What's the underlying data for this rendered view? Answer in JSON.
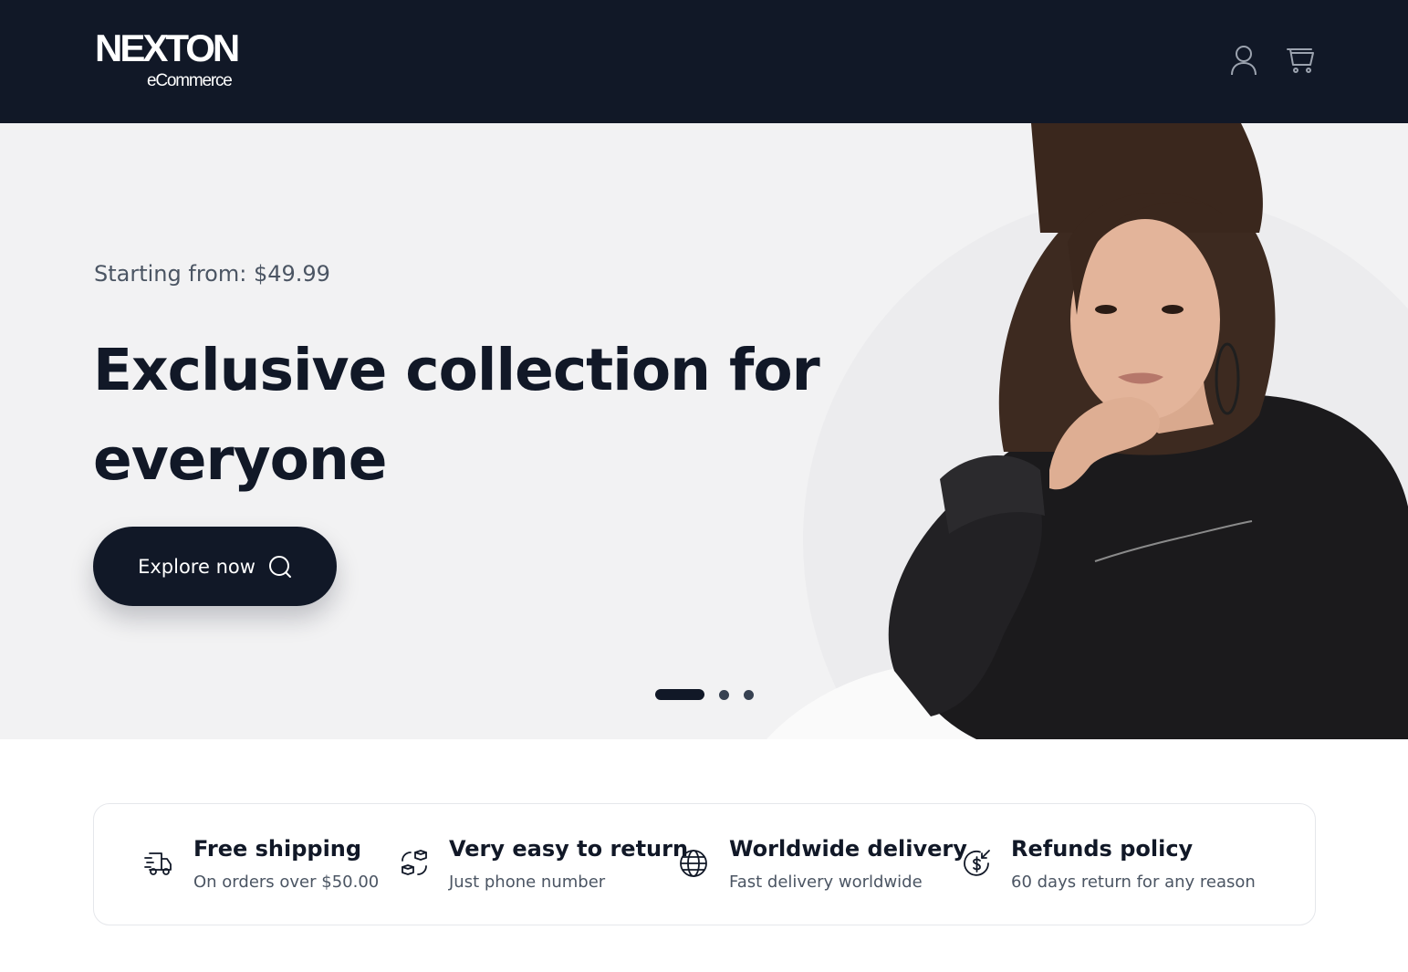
{
  "header": {
    "logo_main": "NEXTON",
    "logo_sub": "eCommerce",
    "icons": [
      "user-icon",
      "cart-icon"
    ]
  },
  "hero": {
    "subtitle": "Starting from: $49.99",
    "title": "Exclusive collection for everyone",
    "button_label": "Explore now",
    "button_icon": "search-icon",
    "slides_total": 3,
    "active_slide": 1
  },
  "features": [
    {
      "icon": "truck-icon",
      "title": "Free shipping",
      "description": "On orders over $50.00"
    },
    {
      "icon": "return-box-icon",
      "title": "Very easy to return",
      "description": "Just phone number"
    },
    {
      "icon": "globe-icon",
      "title": "Worldwide delivery",
      "description": "Fast delivery worldwide"
    },
    {
      "icon": "refund-icon",
      "title": "Refunds policy",
      "description": "60 days return for any reason"
    }
  ],
  "colors": {
    "header_bg": "#111827",
    "hero_bg": "#f2f2f3",
    "text_primary": "#111827",
    "text_secondary": "#4b5563",
    "border": "#e5e7eb"
  }
}
